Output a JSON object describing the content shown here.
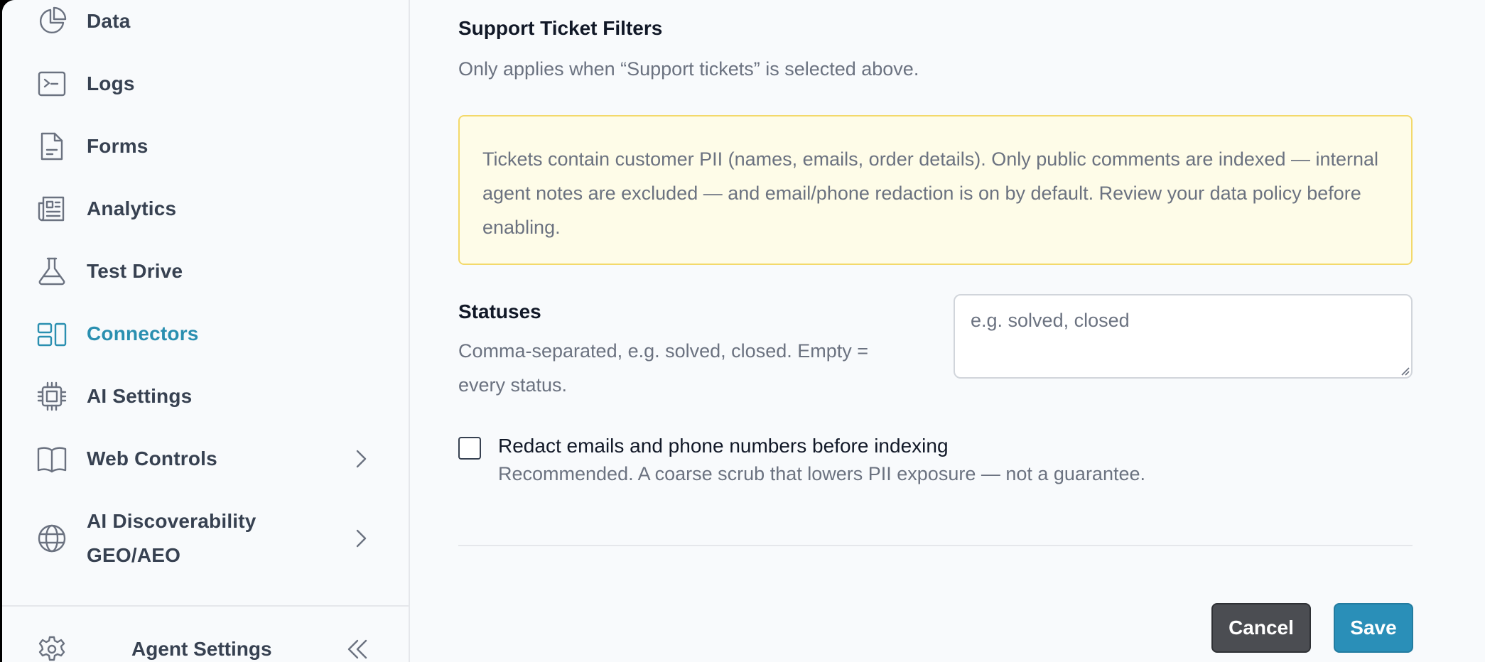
{
  "sidebar": {
    "items": [
      {
        "label": "Data",
        "icon": "pie-chart-icon"
      },
      {
        "label": "Logs",
        "icon": "terminal-icon"
      },
      {
        "label": "Forms",
        "icon": "document-icon"
      },
      {
        "label": "Analytics",
        "icon": "newspaper-icon"
      },
      {
        "label": "Test Drive",
        "icon": "beaker-icon"
      },
      {
        "label": "Connectors",
        "icon": "connectors-icon",
        "active": true
      },
      {
        "label": "AI Settings",
        "icon": "cpu-chip-icon"
      },
      {
        "label": "Web Controls",
        "icon": "book-icon",
        "expandable": true
      },
      {
        "label_line1": "AI Discoverability",
        "label_line2": "GEO/AEO",
        "icon": "globe-icon",
        "expandable": true
      }
    ],
    "footer": {
      "label": "Agent Settings",
      "icon": "gear-icon"
    }
  },
  "main": {
    "section_title": "Support Ticket Filters",
    "section_desc": "Only applies when “Support tickets” is selected above.",
    "warning_text": "Tickets contain customer PII (names, emails, order details). Only public comments are indexed — internal agent notes are excluded — and email/phone redaction is on by default. Review your data policy before enabling.",
    "statuses": {
      "label": "Statuses",
      "help": "Comma-separated, e.g. solved, closed. Empty = every status.",
      "placeholder": "e.g. solved, closed",
      "value": ""
    },
    "redact": {
      "label": "Redact emails and phone numbers before indexing",
      "help": "Recommended. A coarse scrub that lowers PII exposure — not a guarantee.",
      "checked": false
    },
    "buttons": {
      "cancel": "Cancel",
      "save": "Save"
    }
  },
  "colors": {
    "accent": "#2a8fb0",
    "warning_bg": "#fefce8",
    "warning_border": "#f3d96b",
    "cancel_bg": "#4b4d52"
  }
}
